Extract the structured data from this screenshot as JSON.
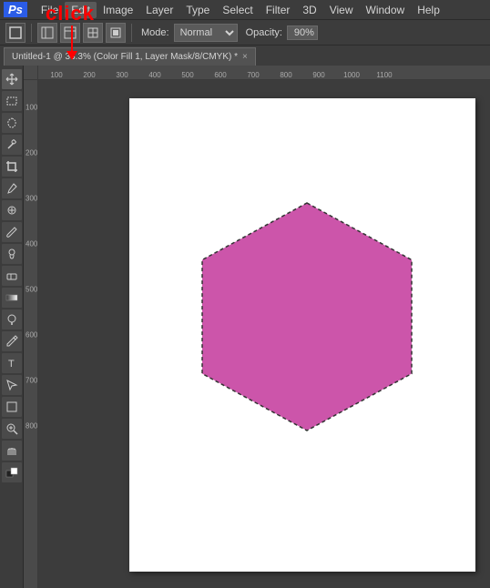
{
  "annotation": {
    "text": "click",
    "color": "red"
  },
  "menubar": {
    "logo": "Ps",
    "items": [
      "File",
      "Edit",
      "Image",
      "Layer",
      "Type",
      "Select",
      "Filter",
      "3D",
      "View",
      "Window",
      "Help"
    ]
  },
  "toolbar": {
    "mode_label": "Mode:",
    "mode_value": "Normal",
    "opacity_label": "Opacity:",
    "opacity_value": "90%"
  },
  "tab": {
    "title": "Untitled-1 @ 33.3% (Color Fill 1, Layer Mask/8/CMYK) *",
    "close": "×"
  },
  "ruler": {
    "h_ticks": [
      "100",
      "200",
      "300",
      "400",
      "500",
      "600",
      "700",
      "800",
      "900",
      "1000",
      "1100"
    ],
    "v_ticks": [
      "100",
      "200",
      "300",
      "400",
      "500",
      "600",
      "700",
      "800"
    ]
  },
  "hexagon": {
    "fill_color": "#cc55aa",
    "stroke_color": "#333",
    "stroke_dasharray": "4,3"
  },
  "tools": [
    {
      "name": "move",
      "icon": "✛"
    },
    {
      "name": "marquee-rect",
      "icon": "▭"
    },
    {
      "name": "marquee-lasso",
      "icon": "⌒"
    },
    {
      "name": "magic-wand",
      "icon": "✦"
    },
    {
      "name": "crop",
      "icon": "⊞"
    },
    {
      "name": "eyedropper",
      "icon": "✒"
    },
    {
      "name": "spot-heal",
      "icon": "⊙"
    },
    {
      "name": "brush",
      "icon": "✏"
    },
    {
      "name": "clone-stamp",
      "icon": "⊕"
    },
    {
      "name": "history",
      "icon": "⟳"
    },
    {
      "name": "eraser",
      "icon": "◻"
    },
    {
      "name": "gradient",
      "icon": "▦"
    },
    {
      "name": "dodge",
      "icon": "○"
    },
    {
      "name": "pen",
      "icon": "✒"
    },
    {
      "name": "text",
      "icon": "T"
    },
    {
      "name": "path-selection",
      "icon": "↖"
    },
    {
      "name": "shape",
      "icon": "▣"
    },
    {
      "name": "zoom",
      "icon": "⌕"
    },
    {
      "name": "hand",
      "icon": "✋"
    },
    {
      "name": "colors",
      "icon": "◑"
    }
  ]
}
